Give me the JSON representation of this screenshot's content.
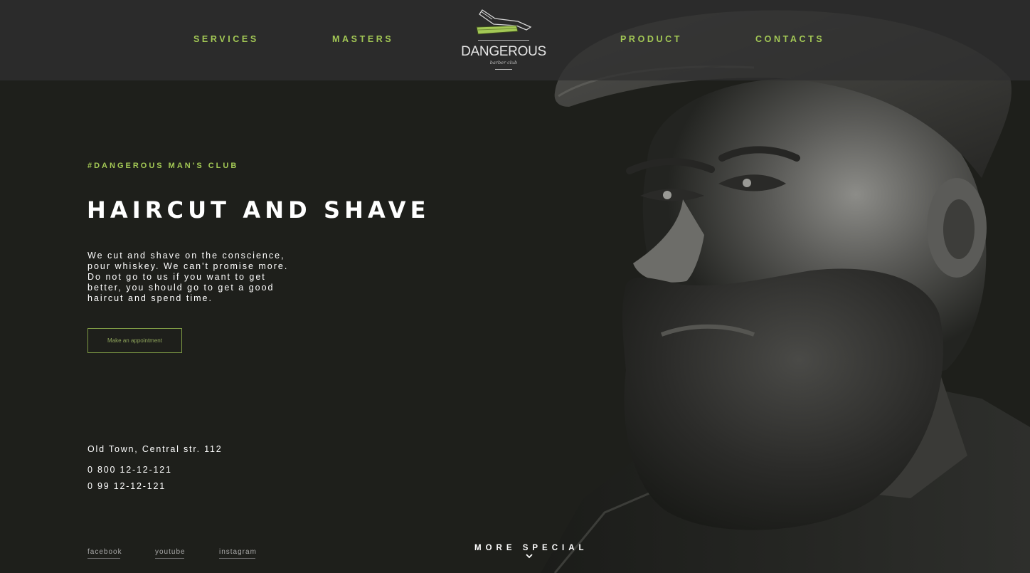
{
  "nav": {
    "items": [
      {
        "label": "SERVICES"
      },
      {
        "label": "MASTERS"
      },
      {
        "label": "PRODUCT"
      },
      {
        "label": "CONTACTS"
      }
    ],
    "logo": {
      "title": "DANGEROUS",
      "subtitle": "barber club",
      "icon": "razor-icon"
    }
  },
  "hero": {
    "tagline": "#DANGEROUS MAN'S CLUB",
    "headline": "HAIRCUT AND SHAVE",
    "description": "We cut and shave on the conscience, pour whiskey. We can't promise more. Do not go to us if you want to get better, you should go to get a good haircut and spend time.",
    "cta_label": "Make an appointment",
    "image": "bearded-man-portrait"
  },
  "contacts": {
    "address": "Old Town, Central str. 112",
    "phones": [
      "0 800 12-12-121",
      "0 99 12-12-121"
    ]
  },
  "social": [
    {
      "label": "facebook"
    },
    {
      "label": "youtube"
    },
    {
      "label": "instagram"
    }
  ],
  "more": {
    "label": "MORE SPECIAL",
    "icon": "chevron-down-icon"
  },
  "colors": {
    "accent": "#a3c855",
    "background": "#1e1f1b",
    "header": "#30302f",
    "text": "#ffffff"
  }
}
